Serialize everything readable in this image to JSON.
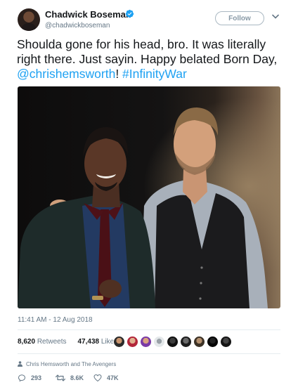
{
  "author": {
    "name": "Chadwick Boseman",
    "handle": "@chadwickboseman",
    "verified": true
  },
  "header": {
    "follow_label": "Follow"
  },
  "tweet": {
    "text_plain_1": "Shoulda gone for his head, bro.  It was literally right there. Just sayin. Happy belated Born Day, ",
    "mention": "@chrishemsworth",
    "text_plain_2": "! ",
    "hashtag": "#InfinityWar",
    "link_color": "#1da1f2"
  },
  "meta": {
    "timestamp": "11:41 AM - 12 Aug 2018"
  },
  "stats": {
    "retweets_count": "8,620",
    "retweets_label": "Retweets",
    "likes_count": "47,438",
    "likes_label": "Likes"
  },
  "context": {
    "text": "Chris Hemsworth and The Avengers",
    "icon": "person-icon"
  },
  "actions": {
    "reply_count": "293",
    "retweet_count": "8.6K",
    "like_count": "47K"
  },
  "icons": {
    "verified": "verified-badge-icon",
    "chevron": "chevron-down-icon",
    "reply": "reply-icon",
    "retweet": "retweet-icon",
    "like": "heart-icon"
  }
}
